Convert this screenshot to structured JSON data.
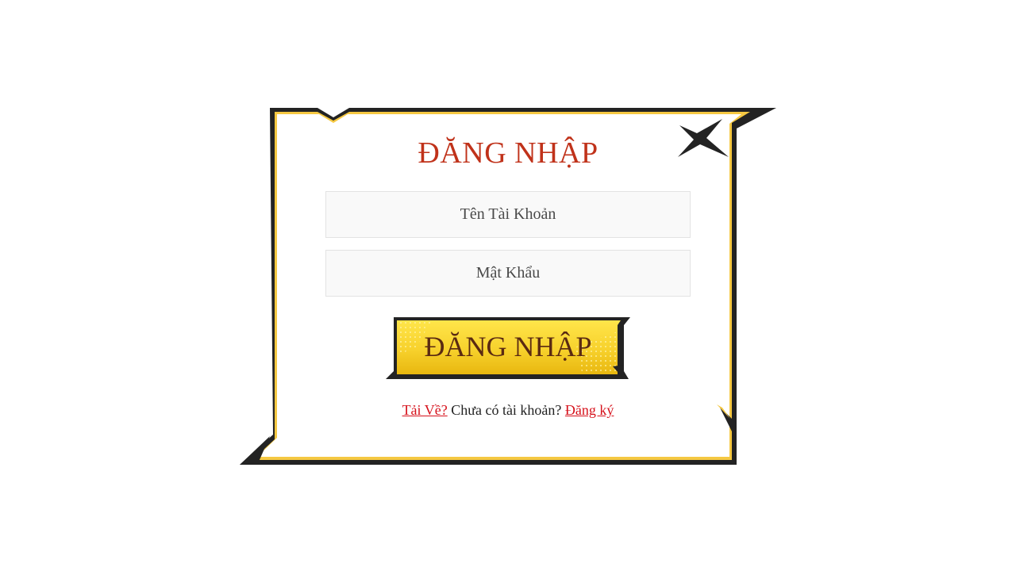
{
  "dialog": {
    "title": "ĐĂNG NHẬP",
    "close_icon": "close-x-icon"
  },
  "form": {
    "username_placeholder": "Tên Tài Khoản",
    "username_value": "",
    "password_placeholder": "Mật Khẩu",
    "password_value": "",
    "submit_label": "ĐĂNG NHẬP"
  },
  "footer": {
    "download_link": "Tải Về?",
    "no_account_text": " Chưa có tài khoản? ",
    "register_link": "Đăng ký"
  },
  "colors": {
    "title": "#c0321a",
    "link": "#d6111b",
    "frame_outline": "#232323",
    "frame_accent": "#f5c842",
    "button_gold": "#f2c81e"
  }
}
